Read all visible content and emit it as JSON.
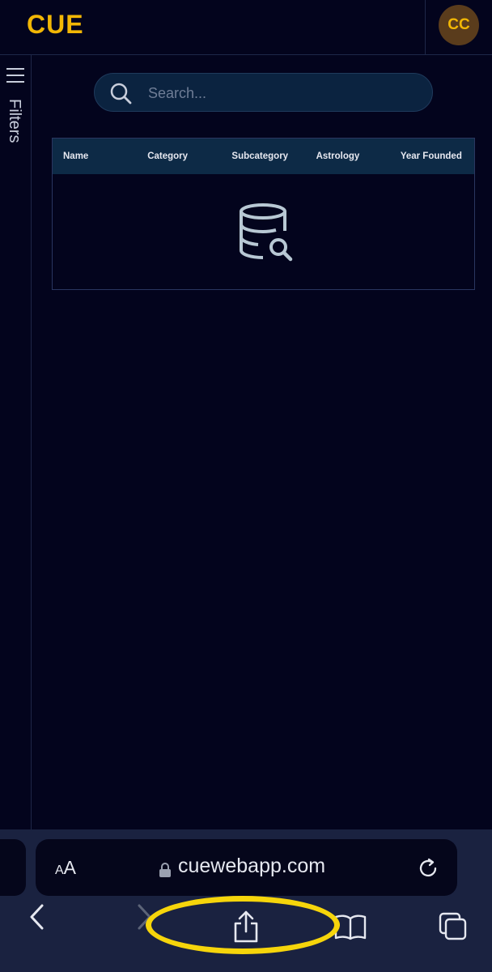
{
  "header": {
    "logo_text": "CUE",
    "avatar_initials": "CC"
  },
  "sidebar": {
    "filters_label": "Filters"
  },
  "search": {
    "placeholder": "Search..."
  },
  "table": {
    "columns": [
      "Name",
      "Category",
      "Subcategory",
      "Astrology",
      "Year Founded"
    ],
    "rows": [],
    "empty_icon": "database-search-icon"
  },
  "browser": {
    "text_size_label_small": "A",
    "text_size_label_big": "A",
    "url": "cuewebapp.com"
  },
  "colors": {
    "accent": "#f2b705",
    "background": "#03041d",
    "table_header": "#0d2a46",
    "highlight": "#f6d50b"
  }
}
